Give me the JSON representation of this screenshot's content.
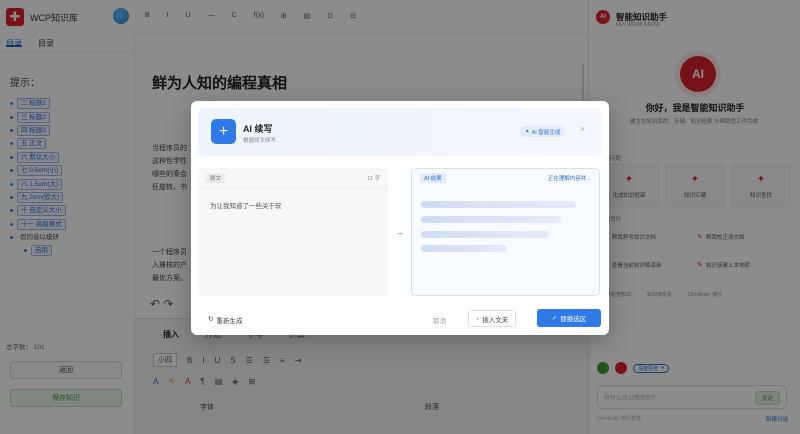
{
  "app": {
    "title": "WCP知识库"
  },
  "sidebar": {
    "tabs": [
      {
        "label": "目录"
      },
      {
        "label": "目录"
      }
    ],
    "outline_title": "提示：",
    "outline_items": [
      {
        "label": "二 标题1"
      },
      {
        "label": "三 标题2"
      },
      {
        "label": "四 标题3"
      },
      {
        "label": "五 正文"
      },
      {
        "label": "六 默认大小"
      },
      {
        "label": "七 0.5em(小)"
      },
      {
        "label": "八 1.5em(大)"
      },
      {
        "label": "九 2em(较大)"
      },
      {
        "label": "十 自定义大小"
      },
      {
        "label": "十一 高级格式"
      },
      {
        "label": "假同音以模研"
      },
      {
        "label": "启用"
      }
    ],
    "word_count": "总字数：   101",
    "return_button": "返回",
    "save_button": "保存知识"
  },
  "editor": {
    "toolbar_icons": [
      "B",
      "I",
      "U",
      "—",
      "C",
      "f(x)",
      "⊞",
      "▤",
      "⊡",
      "⊟"
    ],
    "doc_title": "鲜为人知的编程真相",
    "paragraph1": [
      "当程序员的",
      "这种哲学性",
      "哪些的秦会",
      "狂旋转。书"
    ],
    "paragraph2": [
      "一个程序员",
      "入兼核的产",
      "最优方案。"
    ]
  },
  "ribbon": {
    "tabs": [
      "插入",
      "开始",
      "字号",
      "计算"
    ],
    "font_size": "小四",
    "group_font": "字体",
    "group_paragraph": "段落"
  },
  "assistant": {
    "title": "智能知识助手",
    "subtitle": "KEY WORK KNOW",
    "logo_text": "AI",
    "greeting": "你好，我是智能知识助手",
    "description": "建立在知识库的、存储、知识检索 与帮助您工作完成",
    "section_quick": "快捷问题",
    "cards": [
      {
        "label": "生成知识框架"
      },
      {
        "label": "知识汇编"
      },
      {
        "label": "知识查找"
      }
    ],
    "section_suggest": "猜你想问",
    "questions": [
      {
        "label": "帮我养写知识文档"
      },
      {
        "label": "帮我校正清文档"
      },
      {
        "label": "查看当前知识解读录"
      },
      {
        "label": "知识该建上本地呢"
      }
    ],
    "links": [
      "文件检查知识",
      "知识库优化",
      "Ctrl+Enter 换行"
    ],
    "toggle_label": "深度思考",
    "input_placeholder": "有什么可以帮你的？",
    "send_label": "发送",
    "hint": "Ctrl+Enter 换行发送",
    "hint_right": "新建对话"
  },
  "modal": {
    "title": "AI 续写",
    "subtitle": "根据原文续写",
    "badge": "AI 智能生成",
    "left_tag": "原文",
    "left_count": "11 字",
    "left_text": "为让我知道了一些关于软",
    "right_tag": "AI 结果",
    "right_status": "正在理解内容并...",
    "regenerate": "重新生成",
    "cancel": "取消",
    "insert": "插入文末",
    "replace": "替换选区"
  }
}
